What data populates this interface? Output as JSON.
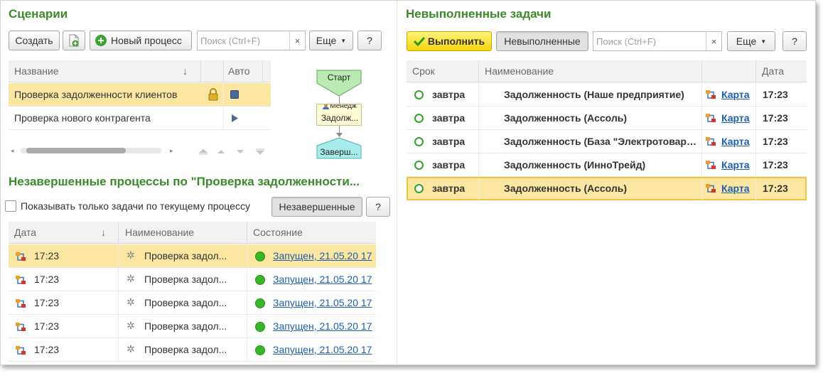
{
  "scenarios": {
    "title": "Сценарии",
    "create_label": "Создать",
    "new_process_label": "Новый процесс",
    "search_placeholder": "Поиск (Ctrl+F)",
    "clear_label": "×",
    "more_label": "Еще",
    "help_label": "?",
    "columns": {
      "name": "Название",
      "sort": "↓",
      "auto": "Авто"
    },
    "rows": [
      {
        "name": "Проверка задолженности клиентов"
      },
      {
        "name": "Проверка нового контрагента"
      }
    ],
    "flow": {
      "start": "Старт",
      "manager": "Менедж",
      "debt": "Задолж...",
      "end": "Заверш..."
    }
  },
  "processes": {
    "title": "Незавершенные процессы по \"Проверка задолженности...",
    "checkbox_label": "Показывать только задачи по текущему процессу",
    "filter_label": "Незавершенные",
    "help_label": "?",
    "columns": {
      "date": "Дата",
      "sort": "↓",
      "name": "Наименование",
      "state": "Состояние"
    },
    "rows": [
      {
        "time": "17:23",
        "name": "Проверка задол...",
        "state": "Запущен, 21.05.20 17"
      },
      {
        "time": "17:23",
        "name": "Проверка задол...",
        "state": "Запущен, 21.05.20 17"
      },
      {
        "time": "17:23",
        "name": "Проверка задол...",
        "state": "Запущен, 21.05.20 17"
      },
      {
        "time": "17:23",
        "name": "Проверка задол...",
        "state": "Запущен, 21.05.20 17"
      },
      {
        "time": "17:23",
        "name": "Проверка задол...",
        "state": "Запущен, 21.05.20 17"
      }
    ]
  },
  "tasks": {
    "title": "Невыполненные задачи",
    "execute_label": "Выполнить",
    "filter_label": "Невыполненные",
    "search_placeholder": "Поиск (Ctrl+F)",
    "clear_label": "×",
    "more_label": "Еще",
    "help_label": "?",
    "columns": {
      "deadline": "Срок",
      "name": "Наименование",
      "date": "Дата"
    },
    "rows": [
      {
        "deadline": "завтра",
        "name": "Задолженность (Наше предприятие)",
        "map": "Карта",
        "date": "17:23"
      },
      {
        "deadline": "завтра",
        "name": "Задолженность (Ассоль)",
        "map": "Карта",
        "date": "17:23"
      },
      {
        "deadline": "завтра",
        "name": "Задолженность (База \"Электротовары\")",
        "map": "Карта",
        "date": "17:23"
      },
      {
        "deadline": "завтра",
        "name": "Задолженность (ИнноТрейд)",
        "map": "Карта",
        "date": "17:23"
      },
      {
        "deadline": "завтра",
        "name": "Задолженность (Ассоль)",
        "map": "Карта",
        "date": "17:23"
      }
    ]
  },
  "colors": {
    "accent_green": "#3a8a2a",
    "selection": "#fbe7a2",
    "link": "#1d5fae",
    "execute_yellow": "#f2d60e"
  },
  "icons": [
    "add-document-icon",
    "plus-circle-icon",
    "lock-icon",
    "stop-icon",
    "play-icon",
    "route-icon",
    "gear-icon",
    "status-dot-icon",
    "checkmark-icon",
    "chevron-down-icon",
    "task-circle-icon",
    "user-icon"
  ]
}
